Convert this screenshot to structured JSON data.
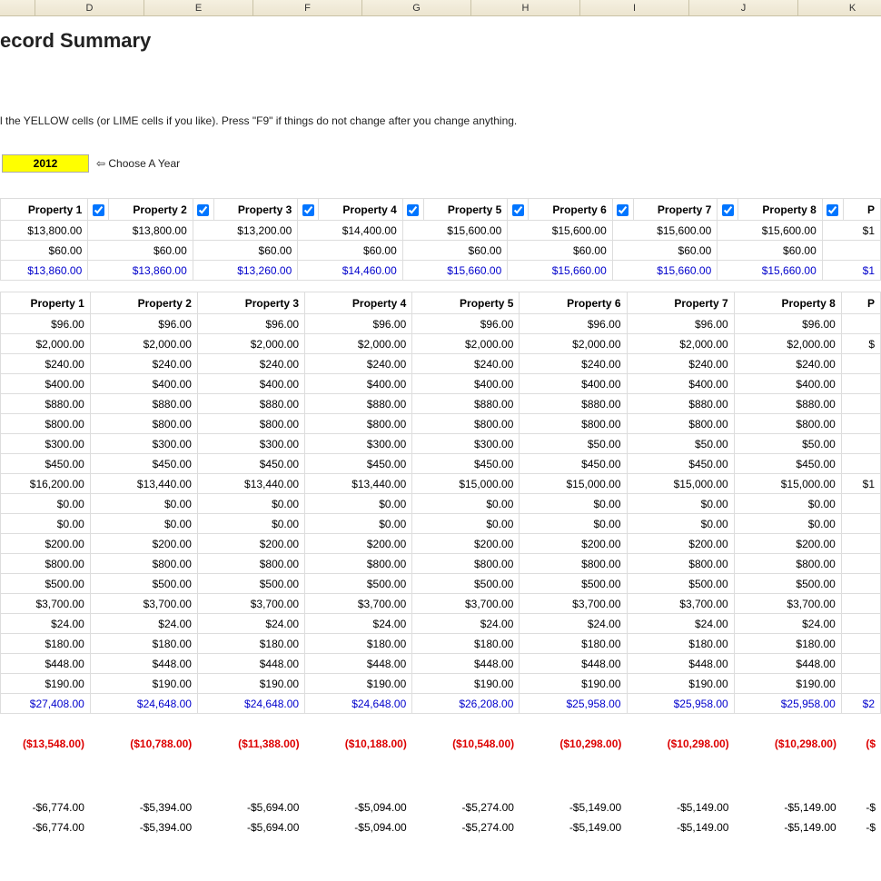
{
  "columnLetters": [
    "D",
    "E",
    "F",
    "G",
    "H",
    "I",
    "J",
    "K"
  ],
  "title": "ecord Summary",
  "instruction": "l the YELLOW cells (or LIME cells if you like). Press \"F9\" if things do not change after you change anything.",
  "year": "2012",
  "chooseYear": "⇦ Choose A Year",
  "propHeaders": [
    "Property 1",
    "Property 2",
    "Property 3",
    "Property 4",
    "Property 5",
    "Property 6",
    "Property 7",
    "Property 8"
  ],
  "propHeader9": "P",
  "table1": {
    "rows": [
      [
        "$13,800.00",
        "$13,800.00",
        "$13,200.00",
        "$14,400.00",
        "$15,600.00",
        "$15,600.00",
        "$15,600.00",
        "$15,600.00",
        "$1"
      ],
      [
        "$60.00",
        "$60.00",
        "$60.00",
        "$60.00",
        "$60.00",
        "$60.00",
        "$60.00",
        "$60.00",
        ""
      ],
      [
        "$13,860.00",
        "$13,860.00",
        "$13,260.00",
        "$14,460.00",
        "$15,660.00",
        "$15,660.00",
        "$15,660.00",
        "$15,660.00",
        "$1"
      ]
    ]
  },
  "table2": {
    "headers": [
      "Property 1",
      "Property 2",
      "Property 3",
      "Property 4",
      "Property 5",
      "Property 6",
      "Property 7",
      "Property 8"
    ],
    "header9": "P",
    "rows": [
      [
        "$96.00",
        "$96.00",
        "$96.00",
        "$96.00",
        "$96.00",
        "$96.00",
        "$96.00",
        "$96.00",
        ""
      ],
      [
        "$2,000.00",
        "$2,000.00",
        "$2,000.00",
        "$2,000.00",
        "$2,000.00",
        "$2,000.00",
        "$2,000.00",
        "$2,000.00",
        "$"
      ],
      [
        "$240.00",
        "$240.00",
        "$240.00",
        "$240.00",
        "$240.00",
        "$240.00",
        "$240.00",
        "$240.00",
        ""
      ],
      [
        "$400.00",
        "$400.00",
        "$400.00",
        "$400.00",
        "$400.00",
        "$400.00",
        "$400.00",
        "$400.00",
        ""
      ],
      [
        "$880.00",
        "$880.00",
        "$880.00",
        "$880.00",
        "$880.00",
        "$880.00",
        "$880.00",
        "$880.00",
        ""
      ],
      [
        "$800.00",
        "$800.00",
        "$800.00",
        "$800.00",
        "$800.00",
        "$800.00",
        "$800.00",
        "$800.00",
        ""
      ],
      [
        "$300.00",
        "$300.00",
        "$300.00",
        "$300.00",
        "$300.00",
        "$50.00",
        "$50.00",
        "$50.00",
        ""
      ],
      [
        "$450.00",
        "$450.00",
        "$450.00",
        "$450.00",
        "$450.00",
        "$450.00",
        "$450.00",
        "$450.00",
        ""
      ],
      [
        "$16,200.00",
        "$13,440.00",
        "$13,440.00",
        "$13,440.00",
        "$15,000.00",
        "$15,000.00",
        "$15,000.00",
        "$15,000.00",
        "$1"
      ],
      [
        "$0.00",
        "$0.00",
        "$0.00",
        "$0.00",
        "$0.00",
        "$0.00",
        "$0.00",
        "$0.00",
        ""
      ],
      [
        "$0.00",
        "$0.00",
        "$0.00",
        "$0.00",
        "$0.00",
        "$0.00",
        "$0.00",
        "$0.00",
        ""
      ],
      [
        "$200.00",
        "$200.00",
        "$200.00",
        "$200.00",
        "$200.00",
        "$200.00",
        "$200.00",
        "$200.00",
        ""
      ],
      [
        "$800.00",
        "$800.00",
        "$800.00",
        "$800.00",
        "$800.00",
        "$800.00",
        "$800.00",
        "$800.00",
        ""
      ],
      [
        "$500.00",
        "$500.00",
        "$500.00",
        "$500.00",
        "$500.00",
        "$500.00",
        "$500.00",
        "$500.00",
        ""
      ],
      [
        "$3,700.00",
        "$3,700.00",
        "$3,700.00",
        "$3,700.00",
        "$3,700.00",
        "$3,700.00",
        "$3,700.00",
        "$3,700.00",
        ""
      ],
      [
        "$24.00",
        "$24.00",
        "$24.00",
        "$24.00",
        "$24.00",
        "$24.00",
        "$24.00",
        "$24.00",
        ""
      ],
      [
        "$180.00",
        "$180.00",
        "$180.00",
        "$180.00",
        "$180.00",
        "$180.00",
        "$180.00",
        "$180.00",
        ""
      ],
      [
        "$448.00",
        "$448.00",
        "$448.00",
        "$448.00",
        "$448.00",
        "$448.00",
        "$448.00",
        "$448.00",
        ""
      ],
      [
        "$190.00",
        "$190.00",
        "$190.00",
        "$190.00",
        "$190.00",
        "$190.00",
        "$190.00",
        "$190.00",
        ""
      ],
      [
        "$27,408.00",
        "$24,648.00",
        "$24,648.00",
        "$24,648.00",
        "$26,208.00",
        "$25,958.00",
        "$25,958.00",
        "$25,958.00",
        "$2"
      ]
    ]
  },
  "lossRow": [
    "($13,548.00)",
    "($10,788.00)",
    "($11,388.00)",
    "($10,188.00)",
    "($10,548.00)",
    "($10,298.00)",
    "($10,298.00)",
    "($10,298.00)",
    "($"
  ],
  "bottomRows": [
    [
      "-$6,774.00",
      "-$5,394.00",
      "-$5,694.00",
      "-$5,094.00",
      "-$5,274.00",
      "-$5,149.00",
      "-$5,149.00",
      "-$5,149.00",
      "-$"
    ],
    [
      "-$6,774.00",
      "-$5,394.00",
      "-$5,694.00",
      "-$5,094.00",
      "-$5,274.00",
      "-$5,149.00",
      "-$5,149.00",
      "-$5,149.00",
      "-$"
    ]
  ]
}
